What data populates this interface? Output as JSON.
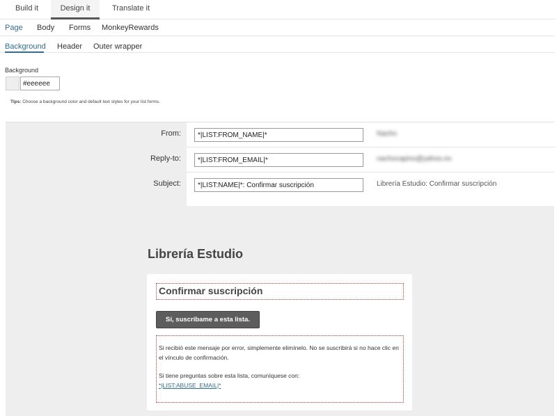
{
  "top_tabs": [
    {
      "label": "Build it",
      "active": false
    },
    {
      "label": "Design it",
      "active": true
    },
    {
      "label": "Translate it",
      "active": false
    }
  ],
  "nav_sections": [
    {
      "label": "Page",
      "active": true
    },
    {
      "label": "Body",
      "active": false
    },
    {
      "label": "Forms",
      "active": false
    },
    {
      "label": "MonkeyRewards",
      "active": false
    }
  ],
  "sub_nav": [
    {
      "label": "Background",
      "active": true
    },
    {
      "label": "Header",
      "active": false
    },
    {
      "label": "Outer wrapper",
      "active": false
    }
  ],
  "background": {
    "label": "Background",
    "color_value": "#eeeeee",
    "swatch_color": "#eeeeee",
    "tips_label": "Tips:",
    "tips_text": "Choose a background color and default text styles for your list forms."
  },
  "email_fields": [
    {
      "label": "From:",
      "value": "*|LIST:FROM_NAME|*",
      "preview": "Nacho"
    },
    {
      "label": "Reply-to:",
      "value": "*|LIST:FROM_EMAIL|*",
      "preview": "nachocapino@yahoo.es"
    },
    {
      "label": "Subject:",
      "value": "*|LIST:NAME|*: Confirmar suscripción",
      "preview": "Librería Estudio: Confirmar suscripción"
    }
  ],
  "email_preview": {
    "brand": "Librería Estudio",
    "title": "Confirmar suscripción",
    "button_label": "Sí, suscríbame a esta lista.",
    "body_line1": "Si recibió este mensaje por error, simplemente elimínelo. No se suscribirá si no hace clic en el vínculo de confirmación.",
    "body_line2": "Si tiene preguntas sobre esta lista, comuníquese con:",
    "abuse_link": "*|LIST:ABUSE_EMAIL|*"
  },
  "colors": {
    "accent": "#2e6f96",
    "preview_bg": "#eeeeee",
    "button_bg": "#5d5d5d",
    "dotted_border": "#b53a3a"
  }
}
